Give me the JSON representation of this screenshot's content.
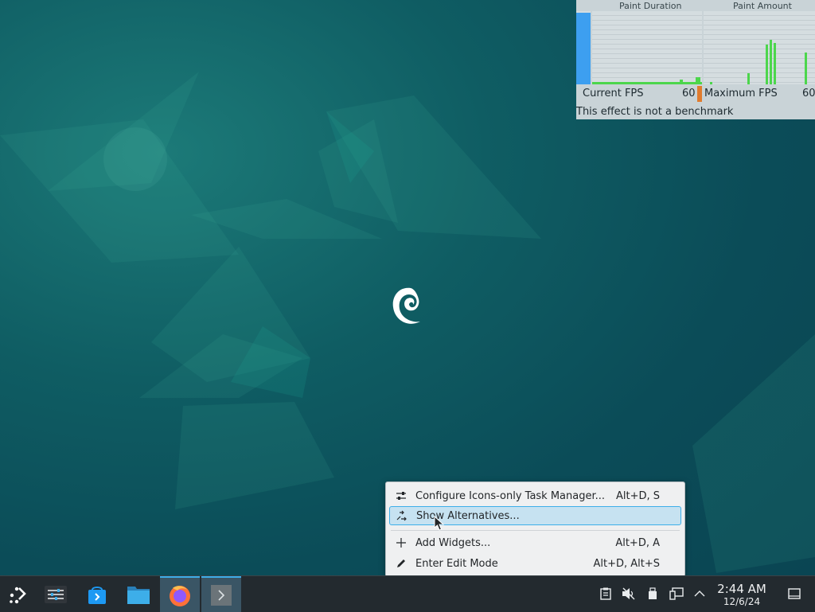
{
  "fps_overlay": {
    "paint_duration_label": "Paint Duration",
    "paint_amount_label": "Paint Amount",
    "current_fps_label": "Current FPS",
    "current_fps_value": "60",
    "maximum_fps_label": "Maximum FPS",
    "maximum_fps_value": "60",
    "note": "This effect is not a benchmark"
  },
  "context_menu": {
    "items": [
      {
        "icon": "configure-icon",
        "label": "Configure Icons-only Task Manager...",
        "shortcut": "Alt+D, S"
      },
      {
        "icon": "alternatives-icon",
        "label": "Show Alternatives...",
        "shortcut": ""
      },
      {
        "icon": "plus-icon",
        "label": "Add Widgets...",
        "shortcut": "Alt+D, A"
      },
      {
        "icon": "edit-icon",
        "label": "Enter Edit Mode",
        "shortcut": "Alt+D, Alt+S"
      }
    ]
  },
  "taskbar": {
    "apps": [
      "application-launcher",
      "system-settings",
      "discover",
      "file-manager",
      "firefox",
      "terminal"
    ],
    "tray_icons": [
      "clipboard-icon",
      "volume-muted-icon",
      "usb-drive-icon",
      "network-icon",
      "expand-tray-icon"
    ],
    "clock_time": "2:44 AM",
    "clock_date": "12/6/24"
  },
  "colors": {
    "accent": "#3daee9",
    "highlight": "#c6e2f1",
    "panel": "#232a2f"
  }
}
